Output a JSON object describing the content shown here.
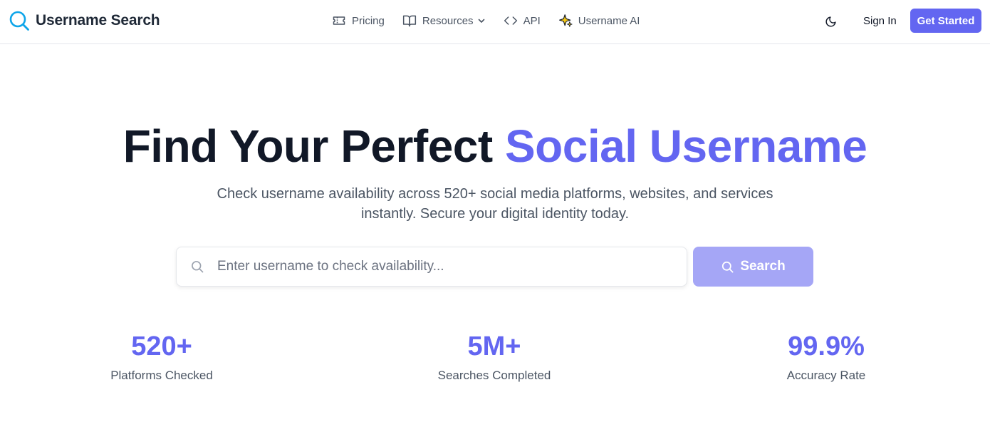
{
  "brand": {
    "name": "Username Search",
    "icon": "search-icon",
    "icon_color": "#0ea5e9"
  },
  "nav": {
    "items": [
      {
        "label": "Pricing",
        "icon": "ticket-icon"
      },
      {
        "label": "Resources",
        "icon": "book-open-icon",
        "dropdown": true
      },
      {
        "label": "API",
        "icon": "code-icon"
      },
      {
        "label": "Username AI",
        "icon": "sparkle-icon"
      }
    ],
    "theme_toggle_icon": "moon-icon",
    "sign_in_label": "Sign In",
    "get_started_label": "Get Started"
  },
  "hero": {
    "title_prefix": "Find Your Perfect",
    "title_accent": "Social Username",
    "subtitle": "Check username availability across 520+ social media platforms, websites, and services instantly. Secure your digital identity today."
  },
  "search": {
    "placeholder": "Enter username to check availability...",
    "value": "",
    "button_label": "Search",
    "button_disabled": true
  },
  "stats": [
    {
      "value": "520+",
      "label": "Platforms Checked"
    },
    {
      "value": "5M+",
      "label": "Searches Completed"
    },
    {
      "value": "99.9%",
      "label": "Accuracy Rate"
    }
  ],
  "colors": {
    "accent": "#6366f1",
    "accent_disabled": "#a5a6f6",
    "text_dark": "#111827",
    "text_muted": "#4b5563",
    "border": "#e5e7eb"
  }
}
